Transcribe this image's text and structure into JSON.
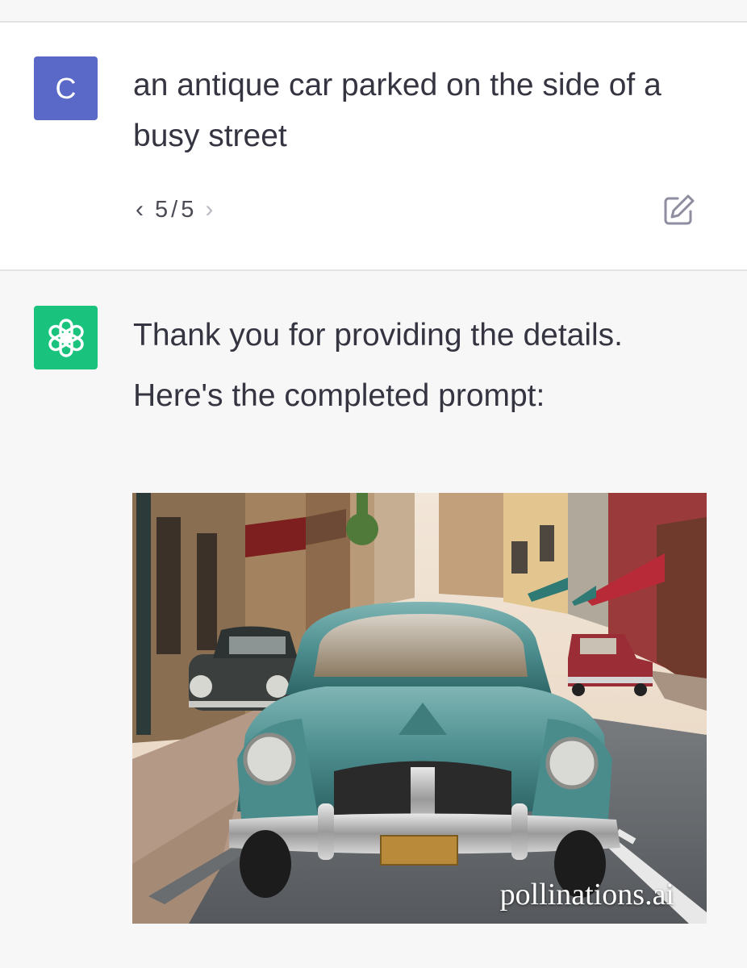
{
  "user_message": {
    "avatar_letter": "C",
    "text": "an antique car parked on the side of a busy street",
    "pager": {
      "prev_icon": "chevron-left-icon",
      "current": "5",
      "separator": "/",
      "total": "5",
      "next_icon": "chevron-right-icon"
    },
    "edit_icon": "edit-icon",
    "avatar_color": "#5a69c8"
  },
  "assistant_message": {
    "avatar_icon": "openai-logo-icon",
    "avatar_color": "#19c37d",
    "lines": [
      "Thank you for providing the details.",
      "Here's the completed prompt:"
    ],
    "image": {
      "watermark": "pollinations.ai"
    }
  }
}
